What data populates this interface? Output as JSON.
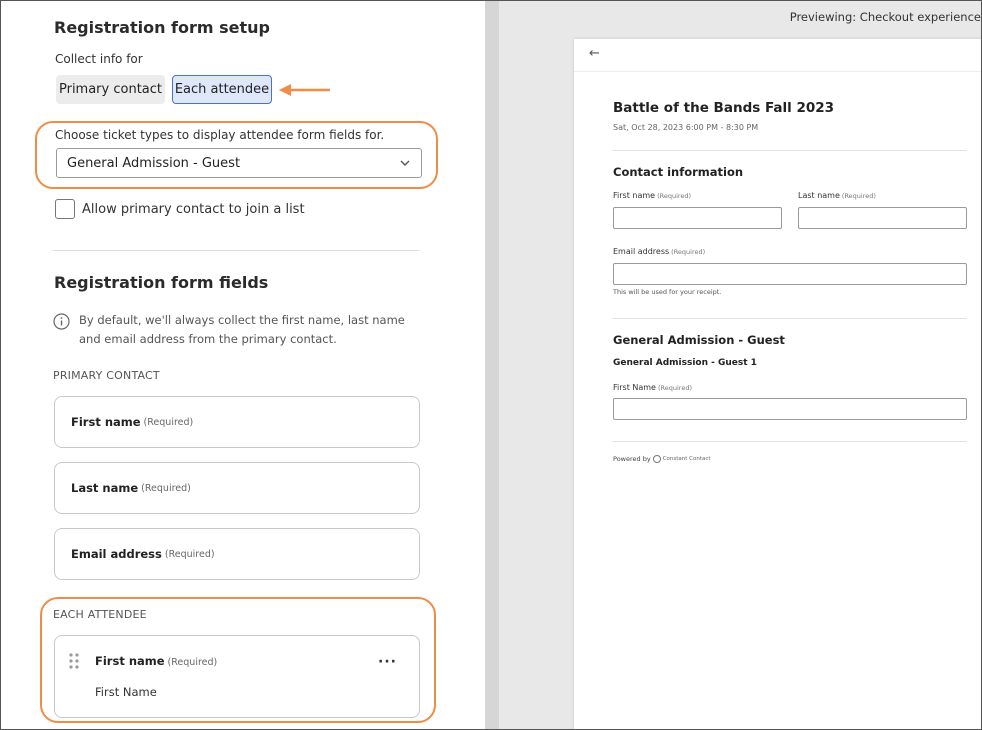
{
  "setup": {
    "title": "Registration form setup",
    "collect_label": "Collect info for",
    "toggle": {
      "primary": "Primary contact",
      "each": "Each attendee"
    },
    "ticket_prompt": "Choose ticket types to display attendee form fields for.",
    "ticket_selected": "General Admission - Guest",
    "join_list_label": "Allow primary contact to join a list"
  },
  "fields": {
    "title": "Registration form fields",
    "info": "By default, we'll always collect the first name, last name and email address from the primary contact.",
    "primary_heading": "PRIMARY CONTACT",
    "required_tag": "(Required)",
    "primary": [
      {
        "label": "First name"
      },
      {
        "label": "Last name"
      },
      {
        "label": "Email address"
      }
    ],
    "each_heading": "EACH ATTENDEE",
    "attendee": {
      "label": "First name",
      "value": "First Name",
      "menu": "···"
    }
  },
  "preview": {
    "label": "Previewing: Checkout experience",
    "back": "←",
    "event_title": "Battle of the Bands Fall 2023",
    "event_date": "Sat, Oct 28, 2023 6:00 PM - 8:30 PM",
    "contact_heading": "Contact information",
    "first_name": "First name",
    "last_name": "Last name",
    "email": "Email address",
    "required": "(Required)",
    "email_hint": "This will be used for your receipt.",
    "ticket_heading": "General Admission - Guest",
    "guest_heading": "General Admission - Guest 1",
    "guest_first_name": "First Name",
    "powered_by": "Powered by",
    "brand": "Constant Contact"
  },
  "colors": {
    "highlight": "#f08c45",
    "active_toggle_border": "#4a6fd6",
    "active_toggle_bg": "#dfe8fb"
  }
}
